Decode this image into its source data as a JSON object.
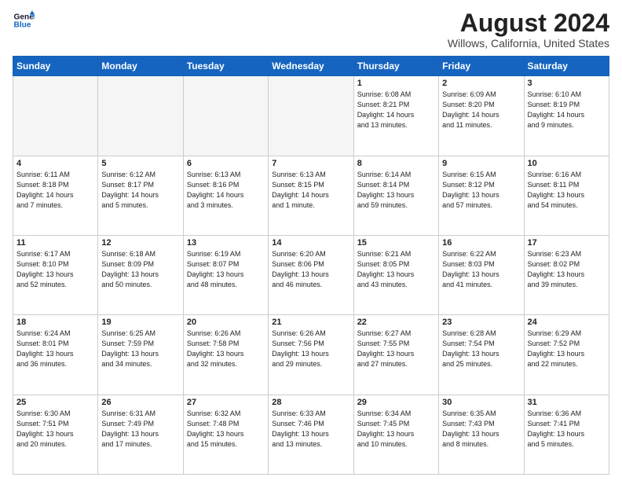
{
  "header": {
    "logo_line1": "General",
    "logo_line2": "Blue",
    "title": "August 2024",
    "subtitle": "Willows, California, United States"
  },
  "weekdays": [
    "Sunday",
    "Monday",
    "Tuesday",
    "Wednesday",
    "Thursday",
    "Friday",
    "Saturday"
  ],
  "weeks": [
    [
      {
        "day": "",
        "info": ""
      },
      {
        "day": "",
        "info": ""
      },
      {
        "day": "",
        "info": ""
      },
      {
        "day": "",
        "info": ""
      },
      {
        "day": "1",
        "info": "Sunrise: 6:08 AM\nSunset: 8:21 PM\nDaylight: 14 hours\nand 13 minutes."
      },
      {
        "day": "2",
        "info": "Sunrise: 6:09 AM\nSunset: 8:20 PM\nDaylight: 14 hours\nand 11 minutes."
      },
      {
        "day": "3",
        "info": "Sunrise: 6:10 AM\nSunset: 8:19 PM\nDaylight: 14 hours\nand 9 minutes."
      }
    ],
    [
      {
        "day": "4",
        "info": "Sunrise: 6:11 AM\nSunset: 8:18 PM\nDaylight: 14 hours\nand 7 minutes."
      },
      {
        "day": "5",
        "info": "Sunrise: 6:12 AM\nSunset: 8:17 PM\nDaylight: 14 hours\nand 5 minutes."
      },
      {
        "day": "6",
        "info": "Sunrise: 6:13 AM\nSunset: 8:16 PM\nDaylight: 14 hours\nand 3 minutes."
      },
      {
        "day": "7",
        "info": "Sunrise: 6:13 AM\nSunset: 8:15 PM\nDaylight: 14 hours\nand 1 minute."
      },
      {
        "day": "8",
        "info": "Sunrise: 6:14 AM\nSunset: 8:14 PM\nDaylight: 13 hours\nand 59 minutes."
      },
      {
        "day": "9",
        "info": "Sunrise: 6:15 AM\nSunset: 8:12 PM\nDaylight: 13 hours\nand 57 minutes."
      },
      {
        "day": "10",
        "info": "Sunrise: 6:16 AM\nSunset: 8:11 PM\nDaylight: 13 hours\nand 54 minutes."
      }
    ],
    [
      {
        "day": "11",
        "info": "Sunrise: 6:17 AM\nSunset: 8:10 PM\nDaylight: 13 hours\nand 52 minutes."
      },
      {
        "day": "12",
        "info": "Sunrise: 6:18 AM\nSunset: 8:09 PM\nDaylight: 13 hours\nand 50 minutes."
      },
      {
        "day": "13",
        "info": "Sunrise: 6:19 AM\nSunset: 8:07 PM\nDaylight: 13 hours\nand 48 minutes."
      },
      {
        "day": "14",
        "info": "Sunrise: 6:20 AM\nSunset: 8:06 PM\nDaylight: 13 hours\nand 46 minutes."
      },
      {
        "day": "15",
        "info": "Sunrise: 6:21 AM\nSunset: 8:05 PM\nDaylight: 13 hours\nand 43 minutes."
      },
      {
        "day": "16",
        "info": "Sunrise: 6:22 AM\nSunset: 8:03 PM\nDaylight: 13 hours\nand 41 minutes."
      },
      {
        "day": "17",
        "info": "Sunrise: 6:23 AM\nSunset: 8:02 PM\nDaylight: 13 hours\nand 39 minutes."
      }
    ],
    [
      {
        "day": "18",
        "info": "Sunrise: 6:24 AM\nSunset: 8:01 PM\nDaylight: 13 hours\nand 36 minutes."
      },
      {
        "day": "19",
        "info": "Sunrise: 6:25 AM\nSunset: 7:59 PM\nDaylight: 13 hours\nand 34 minutes."
      },
      {
        "day": "20",
        "info": "Sunrise: 6:26 AM\nSunset: 7:58 PM\nDaylight: 13 hours\nand 32 minutes."
      },
      {
        "day": "21",
        "info": "Sunrise: 6:26 AM\nSunset: 7:56 PM\nDaylight: 13 hours\nand 29 minutes."
      },
      {
        "day": "22",
        "info": "Sunrise: 6:27 AM\nSunset: 7:55 PM\nDaylight: 13 hours\nand 27 minutes."
      },
      {
        "day": "23",
        "info": "Sunrise: 6:28 AM\nSunset: 7:54 PM\nDaylight: 13 hours\nand 25 minutes."
      },
      {
        "day": "24",
        "info": "Sunrise: 6:29 AM\nSunset: 7:52 PM\nDaylight: 13 hours\nand 22 minutes."
      }
    ],
    [
      {
        "day": "25",
        "info": "Sunrise: 6:30 AM\nSunset: 7:51 PM\nDaylight: 13 hours\nand 20 minutes."
      },
      {
        "day": "26",
        "info": "Sunrise: 6:31 AM\nSunset: 7:49 PM\nDaylight: 13 hours\nand 17 minutes."
      },
      {
        "day": "27",
        "info": "Sunrise: 6:32 AM\nSunset: 7:48 PM\nDaylight: 13 hours\nand 15 minutes."
      },
      {
        "day": "28",
        "info": "Sunrise: 6:33 AM\nSunset: 7:46 PM\nDaylight: 13 hours\nand 13 minutes."
      },
      {
        "day": "29",
        "info": "Sunrise: 6:34 AM\nSunset: 7:45 PM\nDaylight: 13 hours\nand 10 minutes."
      },
      {
        "day": "30",
        "info": "Sunrise: 6:35 AM\nSunset: 7:43 PM\nDaylight: 13 hours\nand 8 minutes."
      },
      {
        "day": "31",
        "info": "Sunrise: 6:36 AM\nSunset: 7:41 PM\nDaylight: 13 hours\nand 5 minutes."
      }
    ]
  ]
}
